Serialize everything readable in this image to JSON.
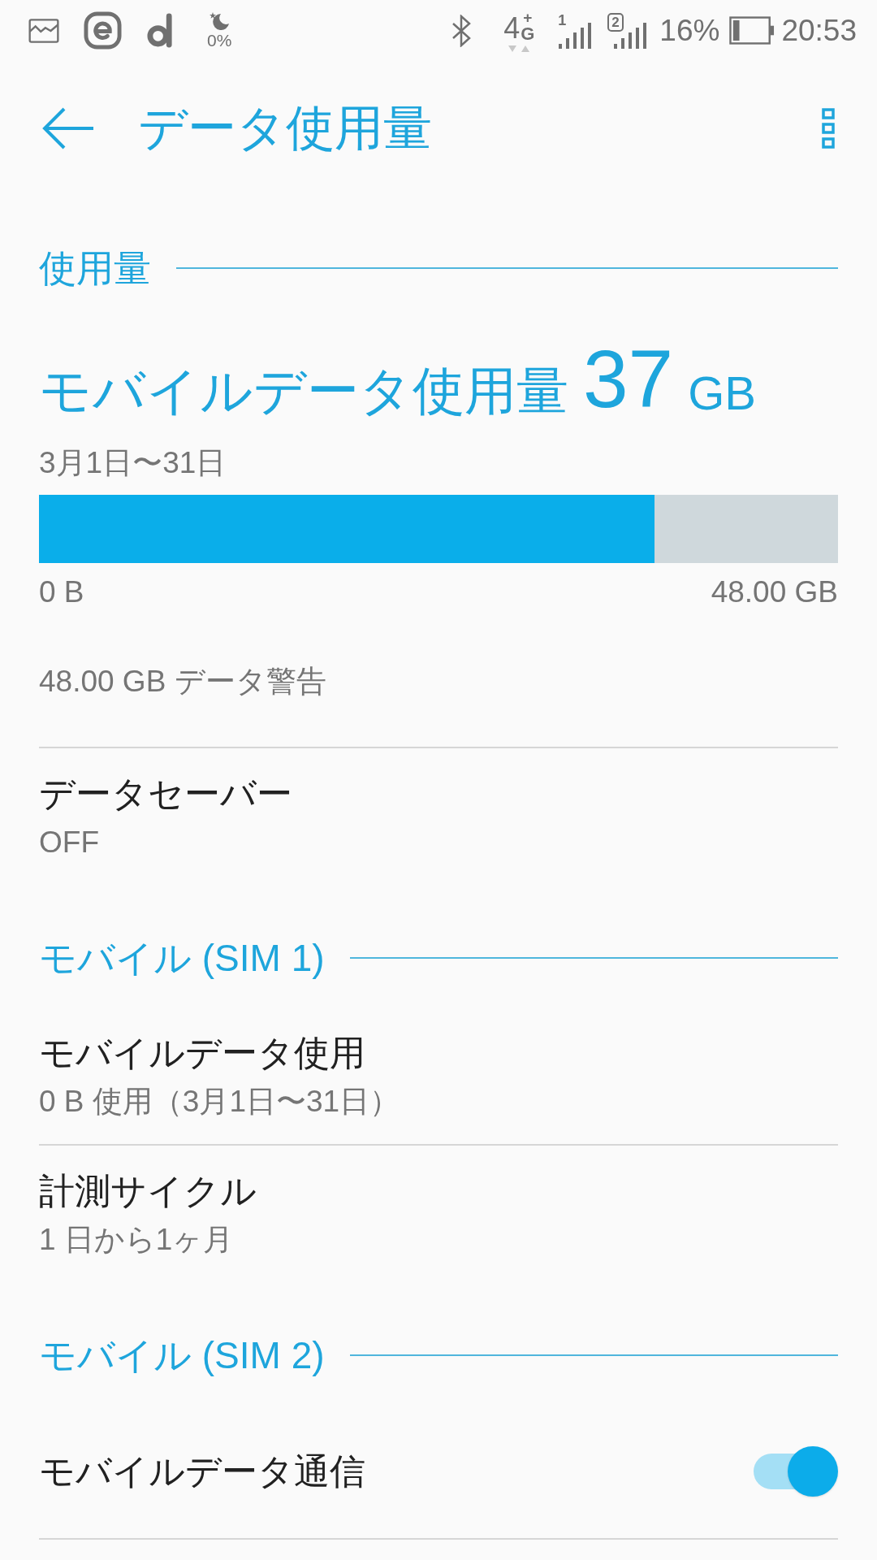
{
  "status_bar": {
    "dnd_level_text": "0%",
    "network_digit": "4",
    "network_plus": "+",
    "network_letter": "G",
    "sim_labels": [
      "1",
      "2"
    ],
    "battery_text": "16%",
    "time": "20:53"
  },
  "toolbar": {
    "title": "データ使用量"
  },
  "usage": {
    "header": "使用量",
    "label": "モバイルデータ使用量",
    "amount": "37",
    "unit": "GB",
    "period": "3月1日〜31日",
    "bar": {
      "level": 0.77
    },
    "bar_start": "0 B",
    "bar_end": "48.00 GB",
    "warning": "48.00 GB データ警告"
  },
  "data_saver": {
    "title": "データセーバー",
    "summary": "OFF"
  },
  "sim_sections": [
    {
      "header": "モバイル (SIM 1)",
      "items": [
        {
          "kind": "detail",
          "title": "モバイルデータ使用",
          "summary": "0 B 使用（3月1日〜31日）"
        },
        {
          "kind": "detail",
          "title": "計測サイクル",
          "summary": "1 日から1ヶ月"
        }
      ]
    },
    {
      "header": "モバイル (SIM 2)",
      "items": [
        {
          "kind": "switch",
          "title": "モバイルデータ通信",
          "on": true
        }
      ]
    }
  ]
}
